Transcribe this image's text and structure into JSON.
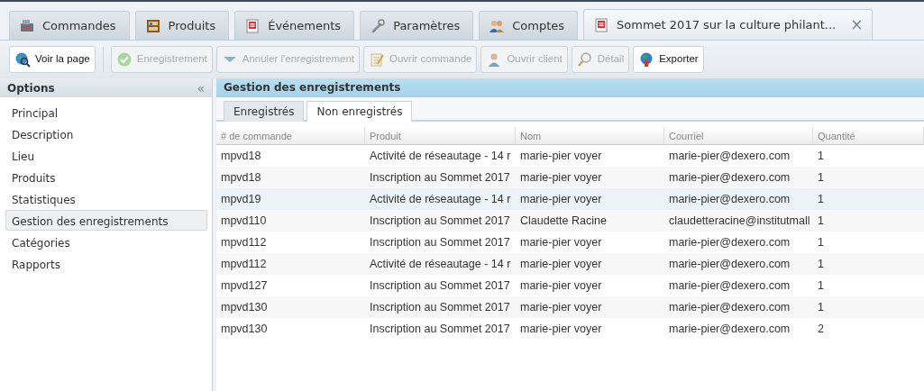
{
  "tabs": [
    {
      "label": "Commandes",
      "selected": false
    },
    {
      "label": "Produits",
      "selected": false
    },
    {
      "label": "Événements",
      "selected": false
    },
    {
      "label": "Paramètres",
      "selected": false
    },
    {
      "label": "Comptes",
      "selected": false
    },
    {
      "label": "Sommet 2017 sur la culture philant...",
      "selected": true,
      "close": "×"
    }
  ],
  "toolbar": [
    {
      "label": "Voir la page",
      "disabled": false
    },
    {
      "label": "Enregistrement",
      "disabled": true
    },
    {
      "label": "Annuler l'enregistrement",
      "disabled": true
    },
    {
      "label": "Ouvrir commande",
      "disabled": true
    },
    {
      "label": "Ouvrir client",
      "disabled": true
    },
    {
      "label": "Détail",
      "disabled": true
    },
    {
      "label": "Exporter",
      "disabled": false
    }
  ],
  "sidebar": {
    "title": "Options",
    "collapse": "«",
    "items": [
      {
        "label": "Principal",
        "selected": false
      },
      {
        "label": "Description",
        "selected": false
      },
      {
        "label": "Lieu",
        "selected": false
      },
      {
        "label": "Produits",
        "selected": false
      },
      {
        "label": "Statistiques",
        "selected": false
      },
      {
        "label": "Gestion des enregistrements",
        "selected": true
      },
      {
        "label": "Catégories",
        "selected": false
      },
      {
        "label": "Rapports",
        "selected": false
      }
    ]
  },
  "panel": {
    "title": "Gestion des enregistrements",
    "subtabs": [
      {
        "label": "Enregistrés",
        "selected": false
      },
      {
        "label": "Non enregistrés",
        "selected": true
      }
    ],
    "table": {
      "columns": [
        "# de commande",
        "Produit",
        "Nom",
        "Courriel",
        "Quantité"
      ],
      "rows": [
        {
          "cells": [
            "mpvd18",
            "Activité de réseautage - 14 r",
            "marie-pier voyer",
            "marie-pier@dexero.com",
            "1"
          ],
          "selected": false
        },
        {
          "cells": [
            "mpvd18",
            "Inscription au Sommet 2017",
            "marie-pier voyer",
            "marie-pier@dexero.com",
            "1"
          ],
          "selected": false
        },
        {
          "cells": [
            "mpvd19",
            "Activité de réseautage - 14 r",
            "marie-pier voyer",
            "marie-pier@dexero.com",
            "1"
          ],
          "selected": true
        },
        {
          "cells": [
            "mpvd110",
            "Inscription au Sommet 2017",
            "Claudette Racine",
            "claudetteracine@institutmall",
            "1"
          ],
          "selected": false
        },
        {
          "cells": [
            "mpvd112",
            "Inscription au Sommet 2017",
            "marie-pier voyer",
            "marie-pier@dexero.com",
            "1"
          ],
          "selected": false
        },
        {
          "cells": [
            "mpvd112",
            "Activité de réseautage - 14 r",
            "marie-pier voyer",
            "marie-pier@dexero.com",
            "1"
          ],
          "selected": false
        },
        {
          "cells": [
            "mpvd127",
            "Inscription au Sommet 2017",
            "marie-pier voyer",
            "marie-pier@dexero.com",
            "1"
          ],
          "selected": false
        },
        {
          "cells": [
            "mpvd130",
            "Inscription au Sommet 2017",
            "marie-pier voyer",
            "marie-pier@dexero.com",
            "1"
          ],
          "selected": false
        },
        {
          "cells": [
            "mpvd130",
            "Inscription au Sommet 2017",
            "marie-pier voyer",
            "marie-pier@dexero.com",
            "2"
          ],
          "selected": false
        }
      ]
    }
  }
}
